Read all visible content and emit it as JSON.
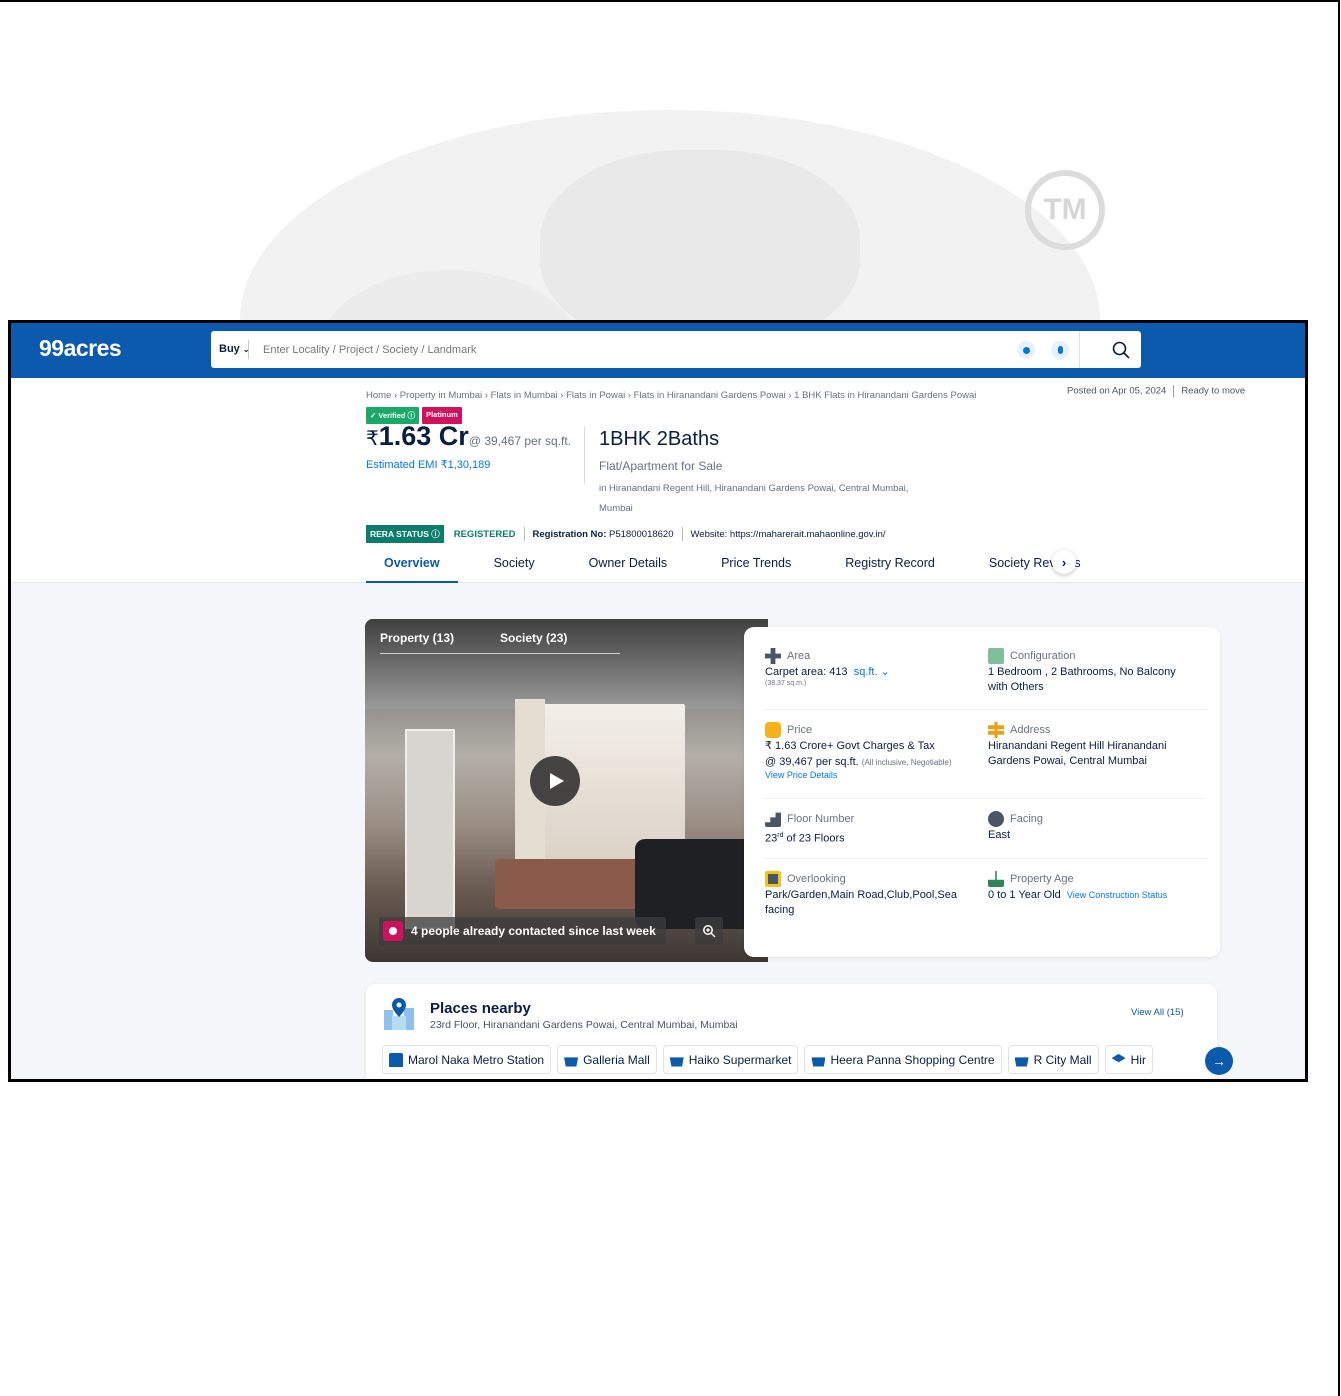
{
  "brand": {
    "logo": "99acres",
    "primary": "#0B5AAE"
  },
  "search": {
    "mode": "Buy",
    "placeholder": "Enter Locality / Project / Society / Landmark"
  },
  "watermark": {
    "tm": "TM"
  },
  "breadcrumb": "Home › Property in Mumbai › Flats in Mumbai › Flats in Powai › Flats in Hiranandani Gardens Powai › 1 BHK Flats in Hiranandani Gardens Powai",
  "posted": {
    "date": "Posted on Apr 05, 2024",
    "status": "Ready to move"
  },
  "badges": {
    "verified": "✓ Verified ⓘ",
    "platinum": "Platinum"
  },
  "price": {
    "symbol": "₹",
    "amount": "1.63 Cr",
    "per_sqft": "@ 39,467 per sq.ft.",
    "emi": "Estimated EMI ₹1,30,189"
  },
  "listing": {
    "title": "1BHK 2Baths",
    "type": "Flat/Apartment for Sale",
    "address": "in Hiranandani Regent Hill, Hiranandani Gardens Powai, Central Mumbai, Mumbai"
  },
  "rera": {
    "tag": "RERA STATUS ⓘ",
    "status": "REGISTERED",
    "reg_label": "Registration No:",
    "reg_no": "P51800018620",
    "website": "Website: https://maharerait.mahaonline.gov.in/"
  },
  "tabs": [
    "Overview",
    "Society",
    "Owner Details",
    "Price Trends",
    "Registry Record",
    "Society Reviews"
  ],
  "tab_arrow": "›",
  "gallery": {
    "tabs": [
      "Property (13)",
      "Society (23)"
    ],
    "contact_text": "4 people already contacted since last week"
  },
  "details": {
    "area": {
      "label": "Area",
      "value": "Carpet area: 413",
      "unit": "sq.ft. ⌄",
      "sub": "(38.37 sq.m.)"
    },
    "configuration": {
      "label": "Configuration",
      "value": "1 Bedroom , 2 Bathrooms, No Balcony with Others"
    },
    "price": {
      "label": "Price",
      "value": "₹ 1.63 Crore+ Govt Charges & Tax",
      "per": "@ 39,467 per sq.ft.",
      "per_note": "(All inclusive, Negotiable)",
      "link": "View Price Details"
    },
    "address": {
      "label": "Address",
      "value": "Hiranandani Regent Hill Hiranandani Gardens Powai, Central Mumbai"
    },
    "floor": {
      "label": "Floor Number",
      "value": "23",
      "sup": "rd",
      "suffix": " of 23 Floors"
    },
    "facing": {
      "label": "Facing",
      "value": "East"
    },
    "overlooking": {
      "label": "Overlooking",
      "value": "Park/Garden,Main Road,Club,Pool,Sea facing"
    },
    "age": {
      "label": "Property Age",
      "value": "0 to 1 Year Old",
      "link": "View Construction Status"
    }
  },
  "places": {
    "title": "Places nearby",
    "subtitle": "23rd Floor, Hiranandani Gardens Powai, Central Mumbai, Mumbai",
    "view_all": "View All (15)",
    "chips": [
      {
        "label": "Marol Naka Metro Station",
        "icon": "metro-icon"
      },
      {
        "label": "Galleria Mall",
        "icon": "mall-icon"
      },
      {
        "label": "Haiko Supermarket",
        "icon": "mall-icon"
      },
      {
        "label": "Heera Panna Shopping Centre",
        "icon": "mall-icon"
      },
      {
        "label": "R City Mall",
        "icon": "mall-icon"
      },
      {
        "label": "Hir",
        "icon": "school-icon"
      }
    ],
    "next": "→"
  }
}
